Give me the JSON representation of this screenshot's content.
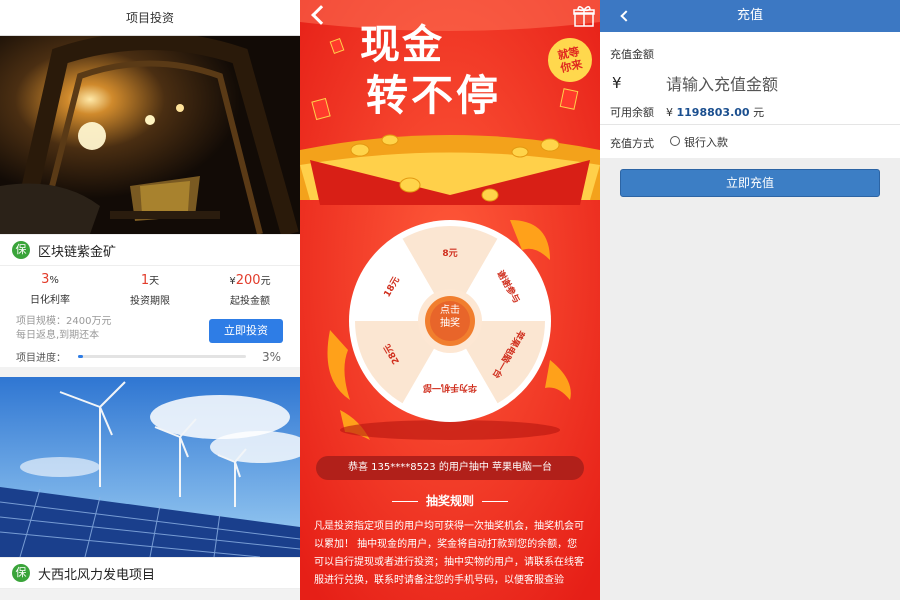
{
  "invest": {
    "title": "项目投资",
    "projects": [
      {
        "badge": "保",
        "name": "区块链紫金矿",
        "rate_value": "3",
        "rate_unit": "%",
        "rate_label": "日化利率",
        "period_value": "1",
        "period_unit": "天",
        "period_label": "投资期限",
        "min_prefix": "¥",
        "min_value": "200",
        "min_unit": "元",
        "min_label": "起投金额",
        "scale_text": "项目规模：2400万元",
        "repay_text": "每日返息,到期还本",
        "progress_label": "项目进度：",
        "progress": 3,
        "progress_text": "3%",
        "button": "立即投资"
      },
      {
        "badge": "保",
        "name": "大西北风力发电项目"
      }
    ]
  },
  "lottery": {
    "hero_line1": "现金",
    "hero_line2": "转不停",
    "badge_line1": "就等",
    "badge_line2": "你来",
    "wheel_segments": [
      "8元",
      "谢谢参与",
      "苹果电脑一台",
      "华为手机一部",
      "28元",
      "18元"
    ],
    "center_line1": "点击",
    "center_line2": "抽奖",
    "winner_text": "恭喜 135****8523 的用户抽中 苹果电脑一台",
    "rules_title": "抽奖规则",
    "rules_text": "凡是投资指定项目的用户均可获得一次抽奖机会，抽奖机会可以累加！ 抽中现金的用户，奖金将自动打款到您的余额，您可以自行提现或者进行投资；抽中实物的用户，请联系在线客服进行兑换，联系时请备注您的手机号码，以便客服查验"
  },
  "recharge": {
    "title": "充值",
    "amount_label": "充值金额",
    "currency_symbol": "¥",
    "amount_placeholder": "请输入充值金额",
    "balance_label": "可用余额",
    "balance_symbol": "¥",
    "balance_value": "1198803.00",
    "balance_unit": "元",
    "method_label": "充值方式",
    "method_option": "银行入款",
    "submit": "立即充值"
  },
  "colors": {
    "accent_blue": "#3c78c3",
    "lottery_red": "#f3281f",
    "rate_red": "#e23c2b",
    "badge_green": "#3aa43a"
  }
}
